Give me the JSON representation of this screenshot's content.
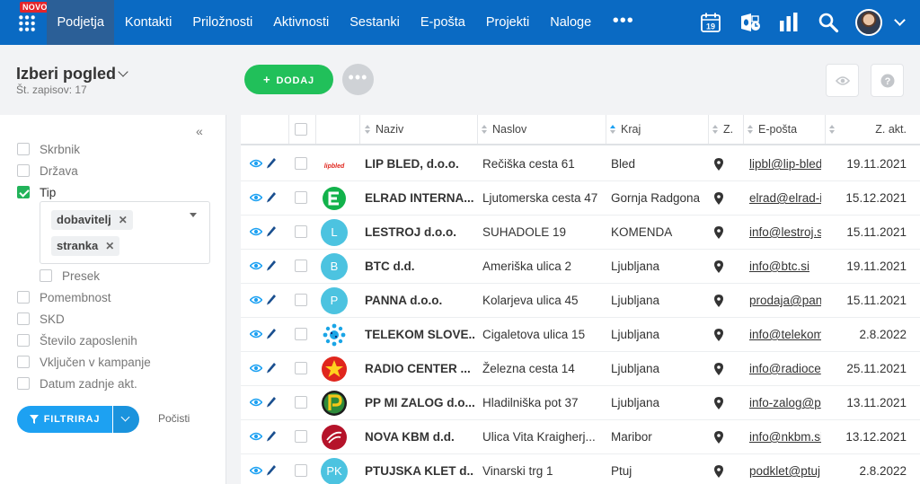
{
  "topbar": {
    "badge": "NOVO",
    "nav": [
      "Podjetja",
      "Kontakti",
      "Priložnosti",
      "Aktivnosti",
      "Sestanki",
      "E-pošta",
      "Projekti",
      "Naloge"
    ],
    "active_index": 0,
    "more": "•••",
    "calendar_day": "19",
    "icons": [
      "apps-grid-icon",
      "calendar-icon",
      "outlook-sync-icon",
      "analytics-icon",
      "search-icon",
      "user-avatar",
      "chevron-down-icon"
    ],
    "accent_color": "#0a6ac3"
  },
  "header": {
    "view_title": "Izberi pogled",
    "record_count": "Št. zapisov: 17",
    "add_label": "DODAJ",
    "add_color": "#21c05a",
    "more_label": "•••"
  },
  "sidebar": {
    "filters_top": [
      {
        "label": "Skrbnik",
        "checked": false
      },
      {
        "label": "Država",
        "checked": false
      },
      {
        "label": "Tip",
        "checked": true
      }
    ],
    "tags": [
      "dobavitelj",
      "stranka"
    ],
    "presek": "Presek",
    "filters_bottom": [
      {
        "label": "Pomembnost",
        "checked": false
      },
      {
        "label": "SKD",
        "checked": false
      },
      {
        "label": "Število zaposlenih",
        "checked": false
      },
      {
        "label": "Vključen v kampanje",
        "checked": false
      },
      {
        "label": "Datum zadnje akt.",
        "checked": false
      }
    ],
    "filter_button": "FILTRIRAJ",
    "clear_link": "Počisti",
    "collapse": "«"
  },
  "table": {
    "columns": {
      "name": "Naziv",
      "address": "Naslov",
      "city": "Kraj",
      "z": "Z.",
      "email": "E-pošta",
      "last": "Z. akt."
    },
    "rows": [
      {
        "name": "LIP BLED, d.o.o.",
        "address": "Rečiška cesta 61",
        "city": "Bled",
        "email": "lipbl@lip-bled",
        "date": "19.11.2021",
        "logo": "lipbled",
        "logo_type": "text",
        "logo_color": "#ffffff"
      },
      {
        "name": "ELRAD INTERNA...",
        "address": "Ljutomerska cesta 47",
        "city": "Gornja Radgona",
        "email": "elrad@elrad-i",
        "date": "15.12.2021",
        "logo": "",
        "logo_type": "elrad",
        "logo_color": "#12b24b"
      },
      {
        "name": "LESTROJ d.o.o.",
        "address": "SUHADOLE 19",
        "city": "KOMENDA",
        "email": "info@lestroj.s",
        "date": "15.11.2021",
        "logo": "L",
        "logo_type": "letter",
        "logo_color": "#4cc3e0"
      },
      {
        "name": "BTC d.d.",
        "address": "Ameriška ulica 2",
        "city": "Ljubljana",
        "email": "info@btc.si",
        "date": "19.11.2021",
        "logo": "B",
        "logo_type": "letter",
        "logo_color": "#4cc3e0"
      },
      {
        "name": "PANNA d.o.o.",
        "address": "Kolarjeva ulica 45",
        "city": "Ljubljana",
        "email": "prodaja@pan",
        "date": "15.11.2021",
        "logo": "P",
        "logo_type": "letter",
        "logo_color": "#4cc3e0"
      },
      {
        "name": "TELEKOM SLOVE...",
        "address": "Cigaletova ulica 15",
        "city": "Ljubljana",
        "email": "info@telekom",
        "date": "2.8.2022",
        "logo": "",
        "logo_type": "telekom",
        "logo_color": "#1aa5e6"
      },
      {
        "name": "RADIO CENTER ...",
        "address": "Železna cesta 14",
        "city": "Ljubljana",
        "email": "info@radioce",
        "date": "25.11.2021",
        "logo": "",
        "logo_type": "radio",
        "logo_color": "#e0261d"
      },
      {
        "name": "PP MI ZALOG d.o...",
        "address": "Hladilniška pot 37",
        "city": "Ljubljana",
        "email": "info-zalog@p",
        "date": "13.11.2021",
        "logo": "",
        "logo_type": "ppmi",
        "logo_color": "#2d8a3a"
      },
      {
        "name": "NOVA KBM d.d.",
        "address": "Ulica Vita Kraigherj...",
        "city": "Maribor",
        "email": "info@nkbm.si",
        "date": "13.12.2021",
        "logo": "",
        "logo_type": "nkbm",
        "logo_color": "#b5132a"
      },
      {
        "name": "PTUJSKA KLET d...",
        "address": "Vinarski trg 1",
        "city": "Ptuj",
        "email": "podklet@ptuj",
        "date": "2.8.2022",
        "logo": "PK",
        "logo_type": "letter",
        "logo_color": "#4cc3e0"
      }
    ]
  }
}
